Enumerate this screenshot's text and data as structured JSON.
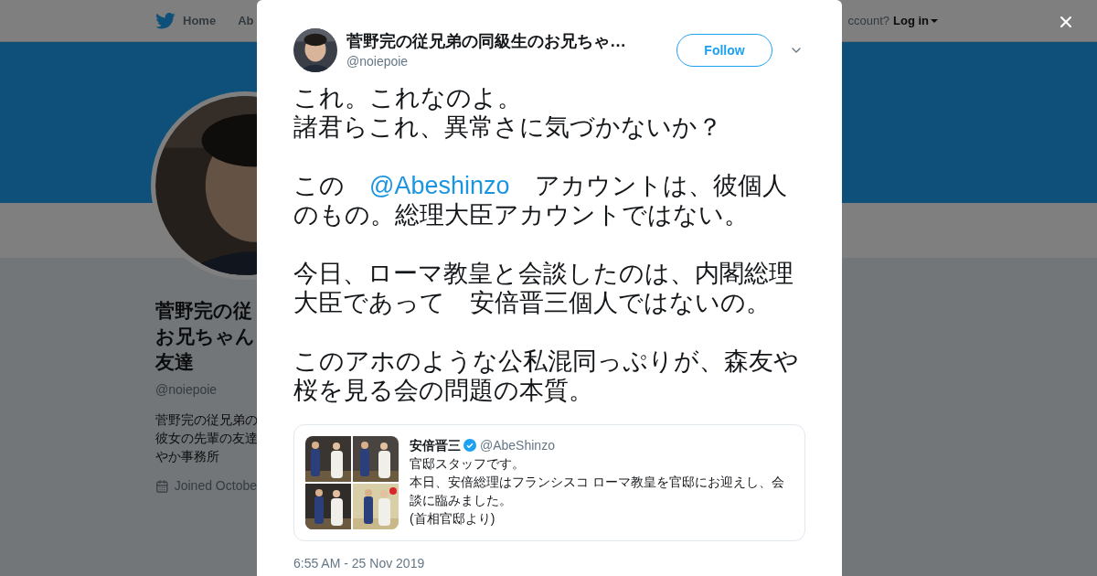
{
  "background": {
    "nav": {
      "items": [
        "Home",
        "Ab"
      ],
      "account_prompt": "ccount?",
      "login": "Log in"
    },
    "profile": {
      "name_lines": [
        "菅野完の従",
        "お兄ちゃん",
        "友達"
      ],
      "handle": "@noiepoie",
      "bio_lines": [
        "菅野完の従兄弟の",
        "彼女の先輩の友達",
        "やか事務所"
      ],
      "joined": "Joined Octobe"
    }
  },
  "tweet": {
    "author": {
      "name": "菅野完の従兄弟の同級生のお兄ちゃ…",
      "handle": "@noiepoie"
    },
    "follow_button": "Follow",
    "paragraphs": [
      [
        {
          "kind": "text",
          "text": "これ。これなのよ。"
        },
        {
          "kind": "break"
        },
        {
          "kind": "text",
          "text": "諸君らこれ、異常さに気づかないか？"
        }
      ],
      [
        {
          "kind": "text",
          "text": "この　"
        },
        {
          "kind": "mention",
          "text": "@Abeshinzo"
        },
        {
          "kind": "text",
          "text": "　アカウントは、彼個人のもの。総理大臣アカウントではない。"
        }
      ],
      [
        {
          "kind": "text",
          "text": "今日、ローマ教皇と会談したのは、内閣総理大臣であって　安倍晋三個人ではないの。"
        }
      ],
      [
        {
          "kind": "text",
          "text": "このアホのような公私混同っぷりが、森友や桜を見る会の問題の本質。"
        }
      ]
    ],
    "quote": {
      "name": "安倍晋三",
      "verified": true,
      "handle": "@AbeShinzo",
      "lines": [
        "官邸スタッフです。",
        "本日、安倍総理はフランシスコ ローマ教皇を官邸にお迎えし、会談に臨みました。",
        "(首相官邸より)"
      ]
    },
    "timestamp": "6:55 AM - 25 Nov 2019"
  }
}
